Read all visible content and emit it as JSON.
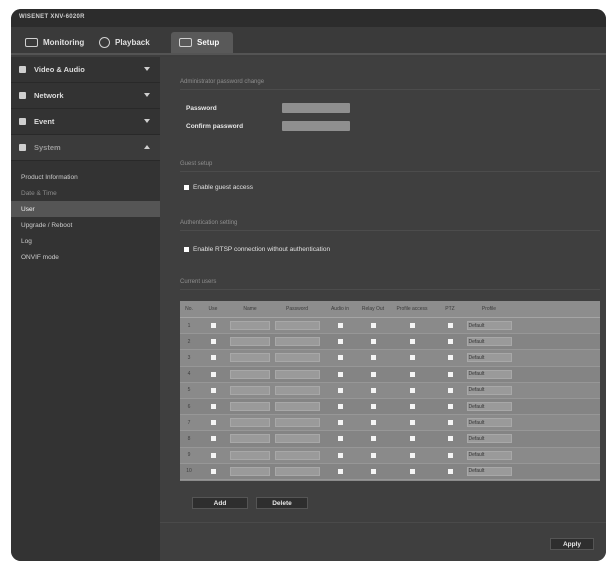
{
  "app": {
    "brand": "WISENET XNV-6020R"
  },
  "tabs": [
    {
      "label": "Monitoring",
      "icon": "monitor-icon"
    },
    {
      "label": "Playback",
      "icon": "playback-icon"
    },
    {
      "label": "Setup",
      "icon": "setup-icon"
    }
  ],
  "sidebar": {
    "main_items": [
      {
        "label": "Video & Audio",
        "icon": "video-icon"
      },
      {
        "label": "Network",
        "icon": "network-icon"
      },
      {
        "label": "Event",
        "icon": "event-icon"
      },
      {
        "label": "System",
        "icon": "system-icon"
      }
    ],
    "sub_items": [
      {
        "label": "Product Information"
      },
      {
        "label": "Date & Time"
      },
      {
        "label": "User"
      },
      {
        "label": "Upgrade / Reboot"
      },
      {
        "label": "Log"
      },
      {
        "label": "ONVIF mode"
      }
    ]
  },
  "content": {
    "admin_section_title": "Administrator password change",
    "password_label": "Password",
    "confirm_label": "Confirm password",
    "guest_section_title": "Guest setup",
    "guest_checkbox_label": "Enable guest access",
    "auth_section_title": "Authentication setting",
    "auth_checkbox_label": "Enable RTSP connection without authentication",
    "user_section_title": "Current users",
    "table": {
      "headers": [
        "No.",
        "Use",
        "Name",
        "Password",
        "Audio in",
        "Relay Out",
        "Profile access",
        "PTZ",
        "Profile",
        ""
      ],
      "rows": [
        {
          "no": "1",
          "profile": "Default"
        },
        {
          "no": "2",
          "profile": "Default"
        },
        {
          "no": "3",
          "profile": "Default"
        },
        {
          "no": "4",
          "profile": "Default"
        },
        {
          "no": "5",
          "profile": "Default"
        },
        {
          "no": "6",
          "profile": "Default"
        },
        {
          "no": "7",
          "profile": "Default"
        },
        {
          "no": "8",
          "profile": "Default"
        },
        {
          "no": "9",
          "profile": "Default"
        },
        {
          "no": "10",
          "profile": "Default"
        }
      ]
    },
    "add_button": "Add",
    "delete_button": "Delete",
    "apply_button": "Apply"
  }
}
